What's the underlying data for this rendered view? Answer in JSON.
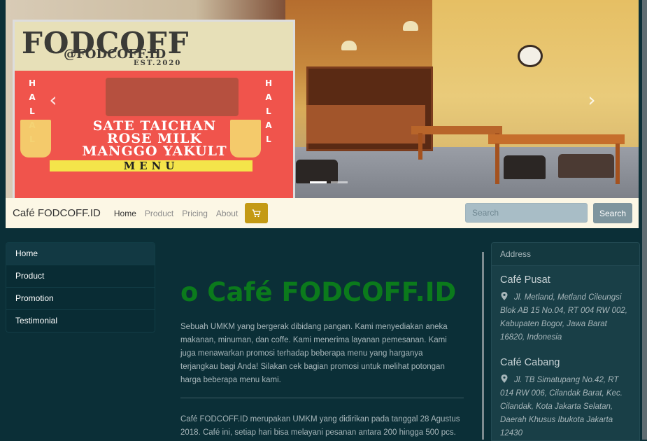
{
  "hero": {
    "banner_brand": "FODCOFF",
    "banner_handle": "@FODCOFF.ID",
    "banner_est": "EST.2020",
    "banner_halal": "HALAL",
    "banner_lines": [
      "SATE TAICHAN",
      "ROSE MILK",
      "MANGGO YAKULT"
    ],
    "banner_menu": "MENU",
    "prev_icon": "chevron-left-icon",
    "next_icon": "chevron-right-icon",
    "slides": 2,
    "active_slide": 1
  },
  "navbar": {
    "brand": "Café FODCOFF.ID",
    "links": [
      "Home",
      "Product",
      "Pricing",
      "About"
    ],
    "active": "Home",
    "cart_icon": "cart-icon",
    "cart_color": "#c49a14",
    "search_placeholder": "Search",
    "search_button": "Search"
  },
  "sidebar": {
    "items": [
      "Home",
      "Product",
      "Promotion",
      "Testimonial"
    ]
  },
  "main": {
    "heading": "o Café FODCOFF.ID",
    "heading_color": "#0b7a1c",
    "paragraph1": "Sebuah UMKM yang bergerak dibidang pangan. Kami menyediakan aneka makanan, minuman, dan coffe. Kami menerima layanan pemesanan. Kami juga menawarkan promosi terhadap beberapa menu yang harganya terjangkau bagi Anda! Silakan cek bagian promosi untuk melihat potongan harga beberapa menu kami.",
    "paragraph2": "Café FODCOFF.ID merupakan UMKM yang didirikan pada tanggal 28 Agustus 2018. Café ini, setiap hari bisa melayani pesanan antara 200 hingga 500 pcs."
  },
  "address": {
    "header": "Address",
    "locations": [
      {
        "title": "Café Pusat",
        "text": "Jl. Metland, Metland Cileungsi Blok AB 15 No.04, RT 004 RW 002, Kabupaten Bogor, Jawa Barat 16820, Indonesia"
      },
      {
        "title": "Café Cabang",
        "text": "Jl. TB Simatupang No.42, RT 014 RW 006, Cilandak Barat, Kec. Cilandak, Kota Jakarta Selatan, Daerah Khusus Ibukota Jakarta 12430"
      }
    ],
    "pin_icon": "map-marker-icon"
  }
}
